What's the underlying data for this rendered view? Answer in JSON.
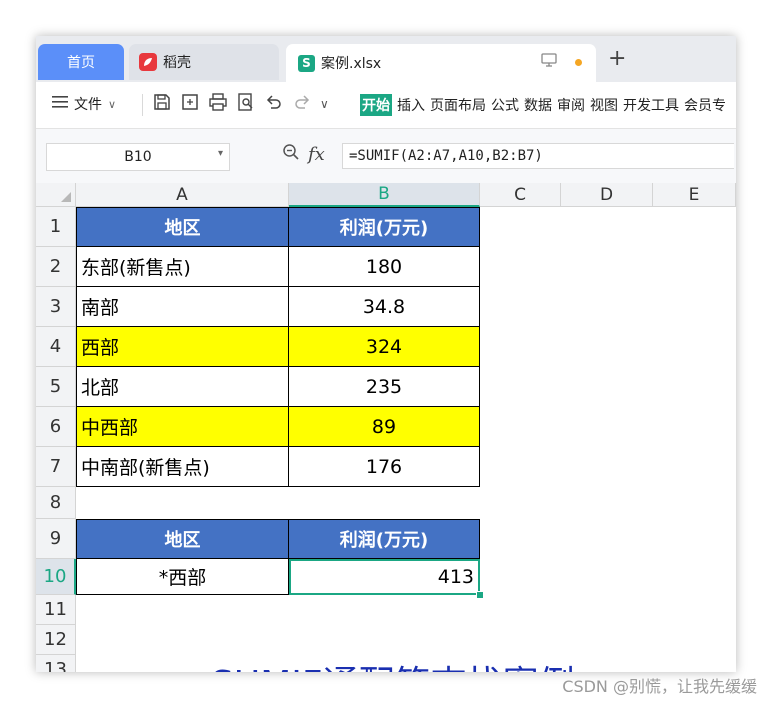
{
  "tabs": {
    "home": "首页",
    "daoke": "稻壳",
    "file": "案例.xlsx",
    "new_tab": "+"
  },
  "toolbar": {
    "file_menu": "文件",
    "ribbon": [
      "开始",
      "插入",
      "页面布局",
      "公式",
      "数据",
      "审阅",
      "视图",
      "开发工具",
      "会员专"
    ]
  },
  "formula_bar": {
    "name_box": "B10",
    "fx": "fx",
    "formula": "=SUMIF(A2:A7,A10,B2:B7)"
  },
  "columns": [
    "A",
    "B",
    "C",
    "D",
    "E"
  ],
  "rows": [
    "1",
    "2",
    "3",
    "4",
    "5",
    "6",
    "7",
    "8",
    "9",
    "10",
    "11",
    "12",
    "13"
  ],
  "table1": {
    "header": [
      "地区",
      "利润(万元)"
    ],
    "rows": [
      [
        "东部(新售点)",
        "180"
      ],
      [
        "南部",
        "34.8"
      ],
      [
        "西部",
        "324"
      ],
      [
        "北部",
        "235"
      ],
      [
        "中西部",
        "89"
      ],
      [
        "中南部(新售点)",
        "176"
      ]
    ]
  },
  "table2": {
    "header": [
      "地区",
      "利润(万元)"
    ],
    "criteria": "*西部",
    "result": "413"
  },
  "title_text": "SUMIF通配符查找案例",
  "watermark": "CSDN @别慌，让我先缓缓",
  "colors": {
    "accent": "#1ba784",
    "header_blue": "#4472c4",
    "highlight": "#ffff00",
    "title": "#1a2fb0"
  }
}
